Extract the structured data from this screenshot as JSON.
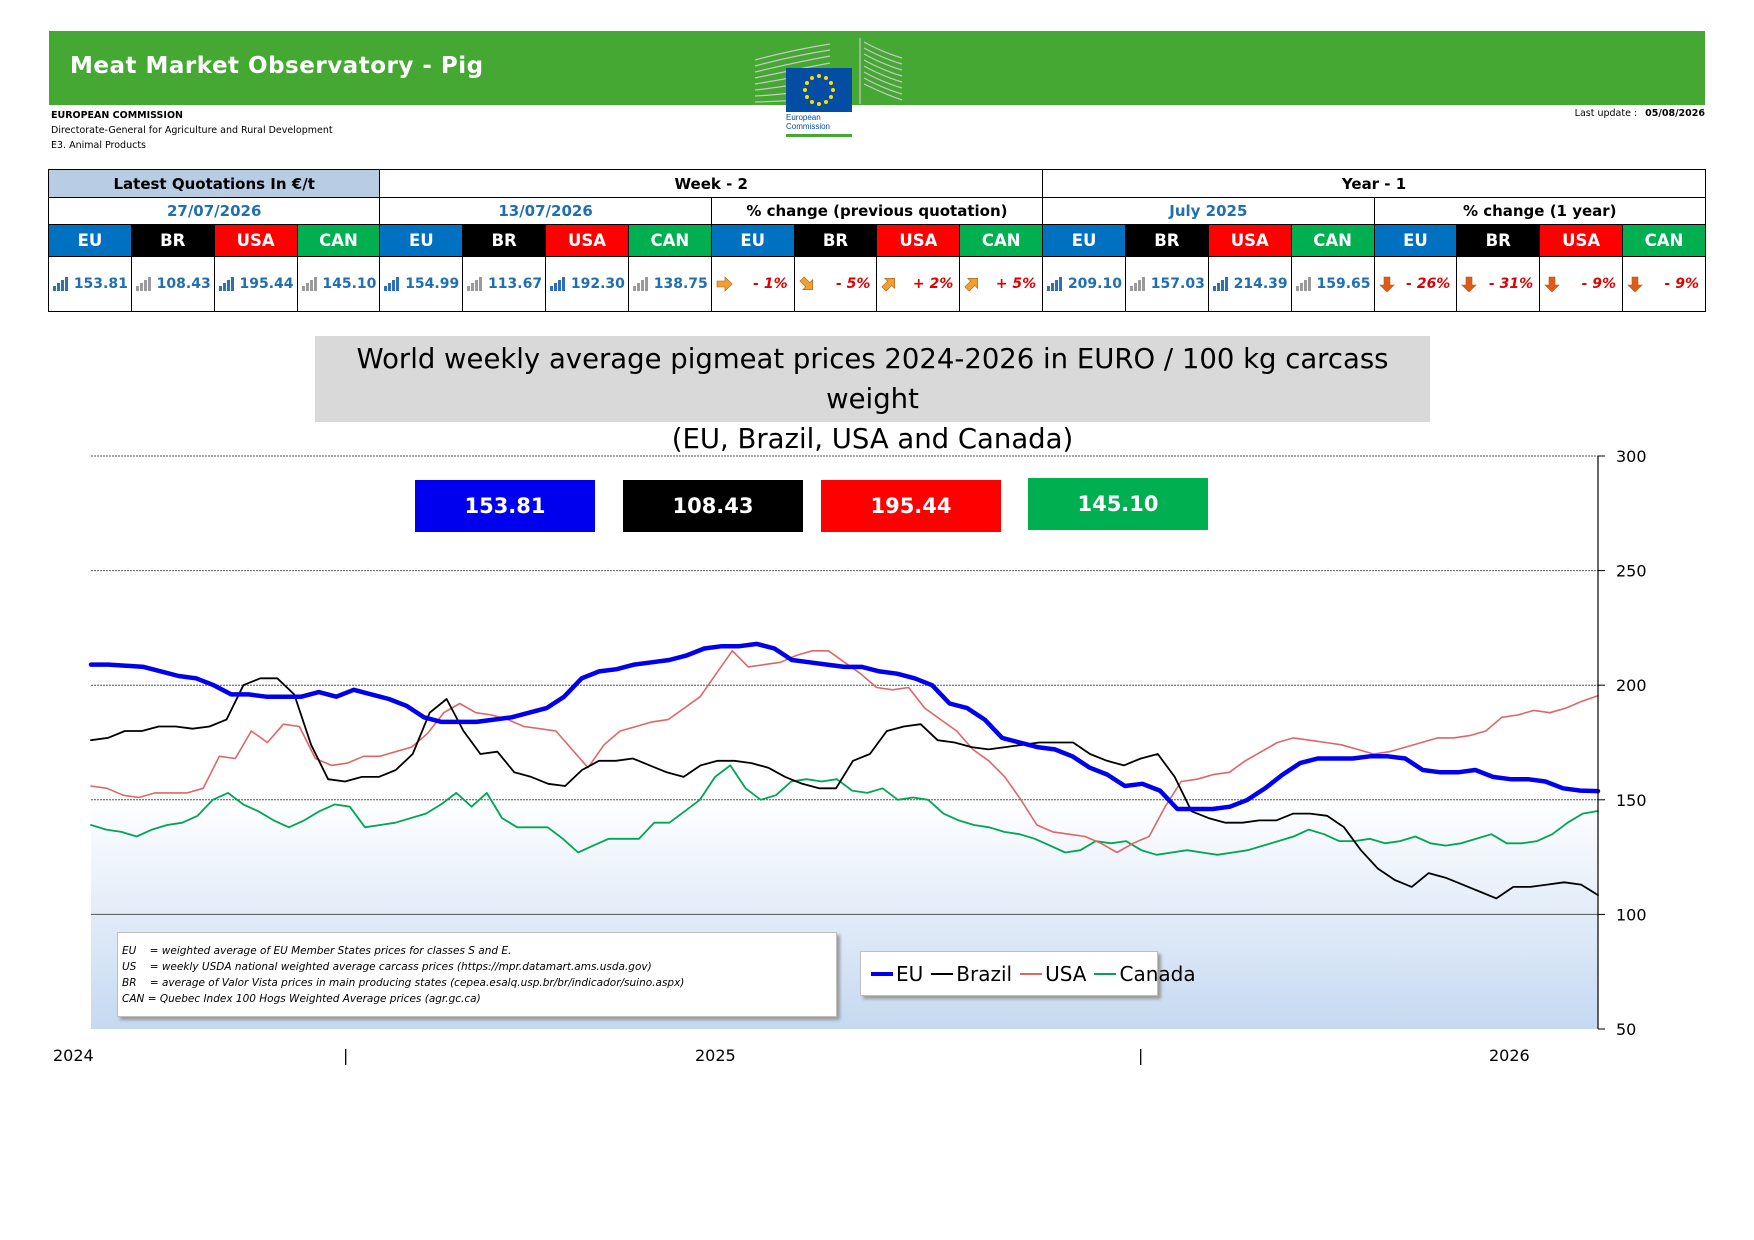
{
  "header": {
    "title": "Meat Market Observatory - Pig",
    "org_lines": [
      "EUROPEAN COMMISSION",
      "Directorate-General for Agriculture and Rural Development",
      "E3. Animal Products"
    ],
    "logo_text": [
      "European",
      "Commission"
    ],
    "last_update_label": "Last update :",
    "last_update": "05/08/2026"
  },
  "quotes": {
    "latest_label": "Latest Quotations In €/t",
    "week_label": "Week - 2",
    "year_label": "Year - 1",
    "latest_date": "27/07/2026",
    "week_date": "13/07/2026",
    "week_change_label": "% change (previous quotation)",
    "year_date": "July 2025",
    "year_change_label": "% change (1 year)",
    "countries": [
      "EU",
      "BR",
      "USA",
      "CAN"
    ],
    "latest": [
      "153.81",
      "108.43",
      "195.44",
      "145.10"
    ],
    "week": [
      "154.99",
      "113.67",
      "192.30",
      "138.75"
    ],
    "week_change": [
      "- 1%",
      "- 5%",
      "+ 2%",
      "+ 5%"
    ],
    "week_arrow": [
      "right",
      "down-right",
      "up-right",
      "up-right"
    ],
    "year": [
      "209.10",
      "157.03",
      "214.39",
      "159.65"
    ],
    "year_change": [
      "- 26%",
      "- 31%",
      "- 9%",
      "- 9%"
    ],
    "year_arrow": [
      "down",
      "down",
      "down",
      "down"
    ]
  },
  "chart_title": {
    "line1": "World weekly average pigmeat prices 2024-2026 in EURO / 100 kg carcass weight",
    "line2": "(EU, Brazil, USA and Canada)"
  },
  "notes": [
    "EU    = weighted average of EU Member States prices for classes S and E.",
    "US    = weekly USDA national weighted average carcass prices (https://mpr.datamart.ams.usda.gov)",
    "BR    = average of Valor Vista prices in main producing states (cepea.esalq.usp.br/br/indicador/suino.aspx)",
    "CAN = Quebec Index 100 Hogs Weighted Average prices (agr.gc.ca)"
  ],
  "colors": {
    "eu": "#0000ee",
    "brazil": "#000000",
    "usa": "#e06666",
    "canada": "#00a651",
    "banner": "#44a832"
  },
  "chart_data": {
    "type": "line",
    "ylim": [
      50,
      300
    ],
    "yticks": [
      50,
      100,
      150,
      200,
      250,
      300
    ],
    "x_ticks": [
      "2024",
      "|",
      "2025",
      "|",
      "2026"
    ],
    "x_tick_weeks": [
      0,
      48,
      96,
      144,
      192
    ],
    "latest_values": [
      "153.81",
      "108.43",
      "195.44",
      "145.10"
    ],
    "x_week_count": 120,
    "series": [
      {
        "name": "EU",
        "key": "eu",
        "values": [
          209,
          209,
          208.5,
          208,
          206,
          204,
          203,
          200,
          196,
          196,
          195,
          195,
          195,
          197,
          195,
          198,
          196,
          194,
          191,
          186,
          184,
          184,
          184,
          185,
          186,
          188,
          190,
          195,
          203,
          206,
          207,
          209,
          210,
          211,
          213,
          216,
          217,
          217,
          218,
          216,
          211,
          210,
          209,
          208,
          208,
          206,
          205,
          203,
          200,
          192,
          190,
          185,
          177,
          175,
          173,
          172,
          169,
          164,
          161,
          156,
          157,
          154,
          146,
          146,
          146,
          147,
          150,
          155,
          161,
          166,
          168,
          168,
          168,
          169,
          169,
          168,
          163,
          162,
          162,
          163,
          160,
          159,
          159,
          158,
          155,
          154,
          153.8
        ]
      },
      {
        "name": "Brazil",
        "key": "brazil",
        "values": [
          176,
          177,
          180,
          180,
          182,
          182,
          181,
          182,
          185,
          200,
          203,
          203,
          196,
          174,
          159,
          158,
          160,
          160,
          163,
          170,
          188,
          194,
          180,
          170,
          171,
          162,
          160,
          157,
          156,
          163,
          167,
          167,
          168,
          165,
          162,
          160,
          165,
          167,
          167,
          166,
          164,
          160,
          157,
          155,
          155,
          167,
          170,
          180,
          182,
          183,
          176,
          175,
          173,
          172,
          173,
          174,
          175,
          175,
          175,
          170,
          167,
          165,
          168,
          170,
          160,
          145,
          142,
          140,
          140,
          141,
          141,
          144,
          144,
          143,
          138,
          128,
          120,
          115,
          112,
          118,
          116,
          113,
          110,
          107,
          112,
          112,
          113,
          114,
          113,
          108.4
        ]
      },
      {
        "name": "USA",
        "key": "usa",
        "values": [
          156,
          155,
          152,
          151,
          153,
          153,
          153,
          155,
          169,
          168,
          180,
          175,
          183,
          182,
          168,
          165,
          166,
          169,
          169,
          171,
          173,
          179,
          188,
          192,
          188,
          187,
          185,
          182,
          181,
          180,
          172,
          164,
          174,
          180,
          182,
          184,
          185,
          190,
          195,
          205,
          215,
          208,
          209,
          210,
          213,
          215,
          215,
          210,
          205,
          199,
          198,
          199,
          190,
          185,
          180,
          172,
          167,
          160,
          150,
          139,
          136,
          135,
          134,
          131,
          127,
          131,
          134,
          147,
          158,
          159,
          161,
          162,
          167,
          171,
          175,
          177,
          176,
          175,
          174,
          172,
          170,
          171,
          173,
          175,
          177,
          177,
          178,
          180,
          186,
          187,
          189,
          188,
          190,
          193,
          195.4
        ]
      },
      {
        "name": "Canada",
        "key": "canada",
        "values": [
          139,
          137,
          136,
          134,
          137,
          139,
          140,
          143,
          150,
          153,
          148,
          145,
          141,
          138,
          141,
          145,
          148,
          147,
          138,
          139,
          140,
          142,
          144,
          148,
          153,
          147,
          153,
          142,
          138,
          138,
          138,
          133,
          127,
          130,
          133,
          133,
          133,
          140,
          140,
          145,
          150,
          160,
          165,
          155,
          150,
          152,
          158,
          159,
          158,
          159,
          154,
          153,
          155,
          150,
          151,
          150,
          144,
          141,
          139,
          138,
          136,
          135,
          133,
          130,
          127,
          128,
          132,
          131,
          132,
          128,
          126,
          127,
          128,
          127,
          126,
          127,
          128,
          130,
          132,
          134,
          137,
          135,
          132,
          132,
          133,
          131,
          132,
          134,
          131,
          130,
          131,
          133,
          135,
          131,
          131,
          132,
          135,
          140,
          144,
          145.1
        ]
      }
    ]
  }
}
